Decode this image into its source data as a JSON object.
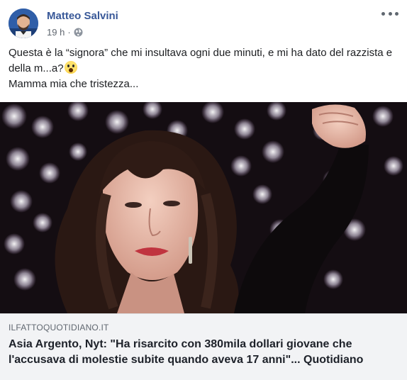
{
  "post": {
    "author": "Matteo Salvini",
    "time": "19 h",
    "separator": "·",
    "privacy_icon": "globe-icon",
    "more_icon": "ellipsis-icon",
    "text_line1": "Questa è la “signora” che mi insultava ogni due minuti, e mi ha dato del razzista e della m...a?",
    "text_emoji": "face-screaming-emoji",
    "text_line2": "Mamma mia che tristezza..."
  },
  "link": {
    "domain": "ILFATTOQUOTIDIANO.IT",
    "headline": "Asia Argento, Nyt: \"Ha risarcito con 380mila dollari giovane che l'accusava di molestie subite quando aveva 17 anni\"... Quotidiano"
  },
  "colors": {
    "author": "#385898",
    "meta": "#606770",
    "text": "#1c1e21",
    "card_bg": "#f2f3f5"
  }
}
